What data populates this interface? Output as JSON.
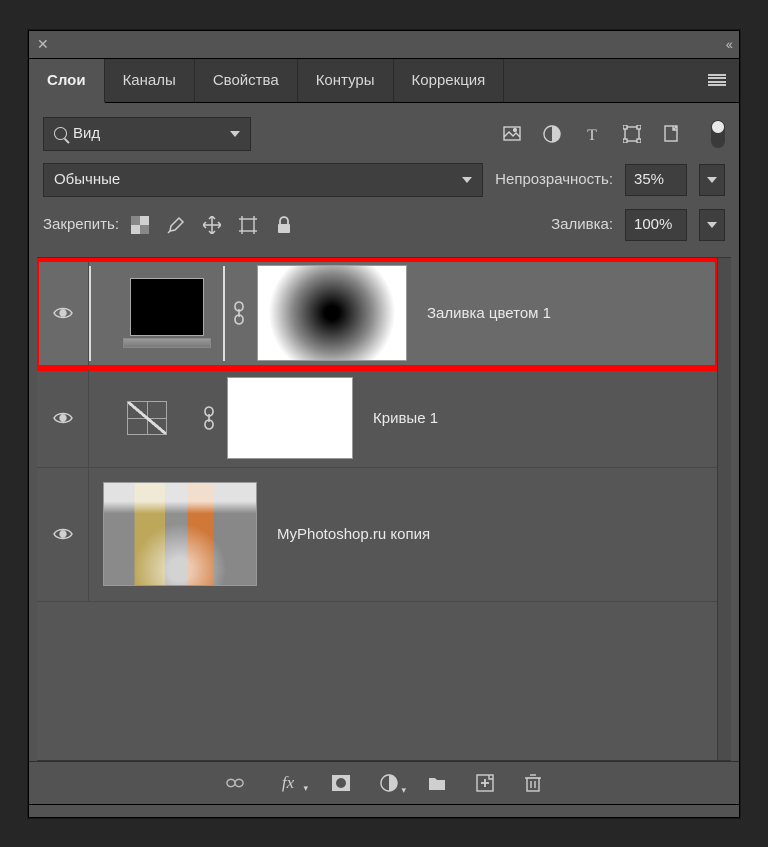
{
  "titlebar": {
    "close": "✕",
    "expand": "‹‹"
  },
  "tabs": {
    "items": [
      "Слои",
      "Каналы",
      "Свойства",
      "Контуры",
      "Коррекция"
    ],
    "activeIndex": 0
  },
  "filterRow": {
    "kind": "Вид"
  },
  "blendRow": {
    "mode": "Обычные",
    "opacityLabel": "Непрозрачность:",
    "opacityValue": "35%"
  },
  "lockRow": {
    "label": "Закрепить:",
    "fillLabel": "Заливка:",
    "fillValue": "100%"
  },
  "layers": [
    {
      "name": "Заливка цветом 1",
      "type": "solid-fill",
      "selected": true,
      "highlighted": true
    },
    {
      "name": "Кривые 1",
      "type": "curves",
      "selected": false
    },
    {
      "name": "MyPhotoshop.ru копия",
      "type": "image",
      "selected": false
    }
  ],
  "footerIcons": [
    "link",
    "fx",
    "mask",
    "adjust",
    "group",
    "new",
    "trash"
  ]
}
